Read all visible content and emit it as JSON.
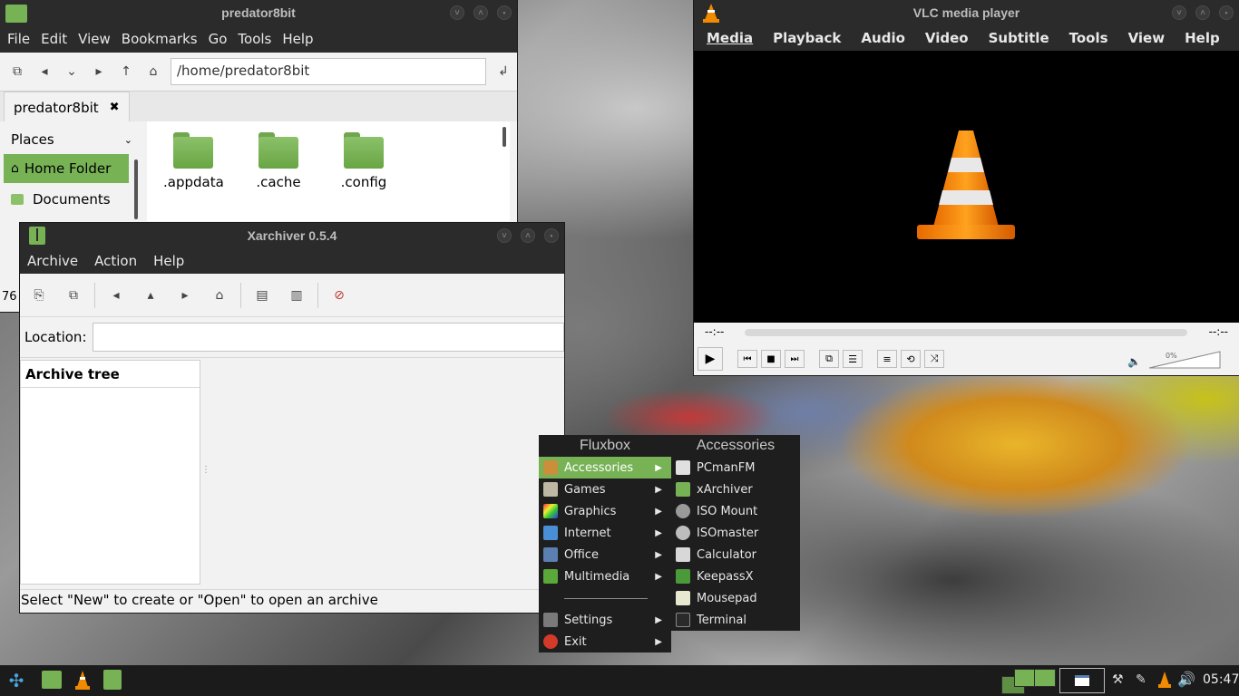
{
  "file_manager": {
    "title": "predator8bit",
    "menu": [
      "File",
      "Edit",
      "View",
      "Bookmarks",
      "Go",
      "Tools",
      "Help"
    ],
    "path": "/home/predator8bit",
    "tab_label": "predator8bit",
    "places_label": "Places",
    "places": [
      "Home Folder",
      "Documents"
    ],
    "folders": [
      ".appdata",
      ".cache",
      ".config"
    ],
    "status_count": "76"
  },
  "xarchiver": {
    "title": "Xarchiver 0.5.4",
    "menu": [
      "Archive",
      "Action",
      "Help"
    ],
    "location_label": "Location:",
    "location_value": "",
    "tree_header": "Archive tree",
    "status": "Select \"New\" to create or \"Open\" to open an archive"
  },
  "vlc": {
    "title": "VLC media player",
    "menu": [
      "Media",
      "Playback",
      "Audio",
      "Video",
      "Subtitle",
      "Tools",
      "View",
      "Help"
    ],
    "time_elapsed": "--:--",
    "time_total": "--:--",
    "volume_percent": "0%"
  },
  "fluxbox_menu": {
    "title": "Fluxbox",
    "items": [
      {
        "label": "Accessories",
        "icon": "accessories-icon",
        "color": "#c98f3a",
        "submenu": true
      },
      {
        "label": "Games",
        "icon": "games-icon",
        "color": "#bdb7a3",
        "submenu": true
      },
      {
        "label": "Graphics",
        "icon": "graphics-icon",
        "color": "#c04ad1",
        "submenu": true
      },
      {
        "label": "Internet",
        "icon": "internet-icon",
        "color": "#4a8ed6",
        "submenu": true
      },
      {
        "label": "Office",
        "icon": "office-icon",
        "color": "#5a7fb0",
        "submenu": true
      },
      {
        "label": "Multimedia",
        "icon": "multimedia-icon",
        "color": "#5aa83a",
        "submenu": true
      }
    ],
    "bottom_items": [
      {
        "label": "Settings",
        "icon": "settings-icon",
        "color": "#7a7a7a",
        "submenu": true
      },
      {
        "label": "Exit",
        "icon": "exit-icon",
        "color": "#d33a2a",
        "submenu": true
      }
    ]
  },
  "accessories_menu": {
    "title": "Accessories",
    "items": [
      {
        "label": "PCmanFM",
        "icon": "pcmanfm-icon",
        "color": "#e0e0e0"
      },
      {
        "label": "xArchiver",
        "icon": "xarchiver-icon",
        "color": "#77b255"
      },
      {
        "label": "ISO Mount",
        "icon": "iso-mount-icon",
        "color": "#9a9a9a"
      },
      {
        "label": "ISOmaster",
        "icon": "isomaster-icon",
        "color": "#bdbdbd"
      },
      {
        "label": "Calculator",
        "icon": "calculator-icon",
        "color": "#d8d8d8"
      },
      {
        "label": "KeepassX",
        "icon": "keepassx-icon",
        "color": "#4a9a3a"
      },
      {
        "label": "Mousepad",
        "icon": "mousepad-icon",
        "color": "#e8e8d0"
      },
      {
        "label": "Terminal",
        "icon": "terminal-icon",
        "color": "#2a2a2a"
      }
    ]
  },
  "taskbar": {
    "clock": "05:47",
    "accent": "#77b255"
  }
}
